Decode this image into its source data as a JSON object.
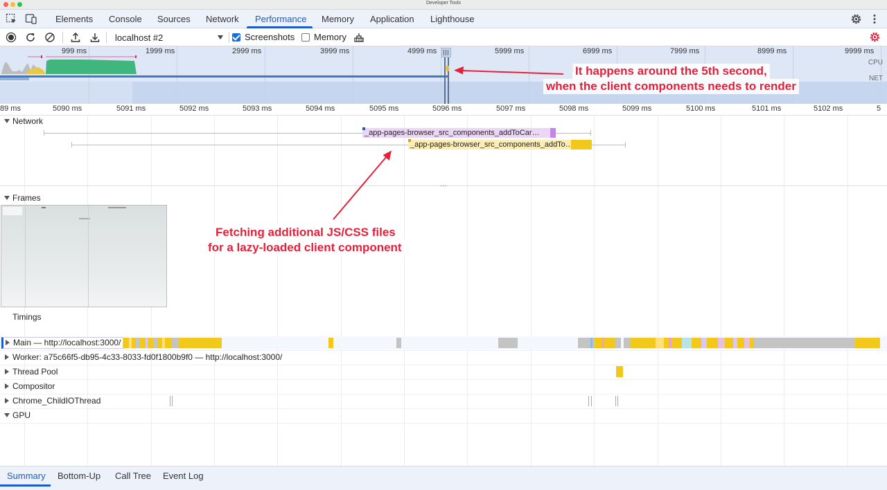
{
  "window": {
    "title": "Developer Tools"
  },
  "tabs": [
    {
      "label": "Elements"
    },
    {
      "label": "Console"
    },
    {
      "label": "Sources"
    },
    {
      "label": "Network"
    },
    {
      "label": "Performance"
    },
    {
      "label": "Memory"
    },
    {
      "label": "Application"
    },
    {
      "label": "Lighthouse"
    }
  ],
  "active_tab": "Performance",
  "toolbar": {
    "profile": "localhost #2",
    "screenshots_label": "Screenshots",
    "screenshots_checked": true,
    "memory_label": "Memory",
    "memory_checked": false
  },
  "overview": {
    "ticks": [
      "999 ms",
      "1999 ms",
      "2999 ms",
      "3999 ms",
      "4999 ms",
      "5999 ms",
      "6999 ms",
      "7999 ms",
      "8999 ms",
      "9999 ms"
    ],
    "cpu_label": "CPU",
    "net_label": "NET"
  },
  "ruler": {
    "ticks": [
      "89 ms",
      "5090 ms",
      "5091 ms",
      "5092 ms",
      "5093 ms",
      "5094 ms",
      "5095 ms",
      "5096 ms",
      "5097 ms",
      "5098 ms",
      "5099 ms",
      "5100 ms",
      "5101 ms",
      "5102 ms",
      "5"
    ]
  },
  "tracks": {
    "network": "Network",
    "requests": [
      {
        "label": "_app-pages-browser_src_components_addToCar…",
        "color": "#e8c7f4"
      },
      {
        "label": "_app-pages-browser_src_components_addTo…",
        "color": "#fbe9a6"
      }
    ],
    "frames": "Frames",
    "timings": "Timings",
    "main": "Main — http://localhost:3000/",
    "worker": "Worker: a75c66f5-db95-4c33-8033-fd0f1800b9f0 — http://localhost:3000/",
    "thread_pool": "Thread Pool",
    "compositor": "Compositor",
    "child_io": "Chrome_ChildIOThread",
    "gpu": "GPU"
  },
  "annotations": {
    "top_line1": "It happens around the 5th second,",
    "top_line2": "when the client components needs to render",
    "mid_line1": "Fetching additional JS/CSS files",
    "mid_line2": "for a lazy-loaded client component"
  },
  "bottom_tabs": [
    {
      "label": "Summary"
    },
    {
      "label": "Bottom-Up"
    },
    {
      "label": "Call Tree"
    },
    {
      "label": "Event Log"
    }
  ],
  "colors": {
    "accent": "#1a5cc4",
    "annotation": "#e3213a",
    "scripting": "#f2c81a",
    "system": "#c4c4c4",
    "cpu_green": "#40b67e"
  }
}
